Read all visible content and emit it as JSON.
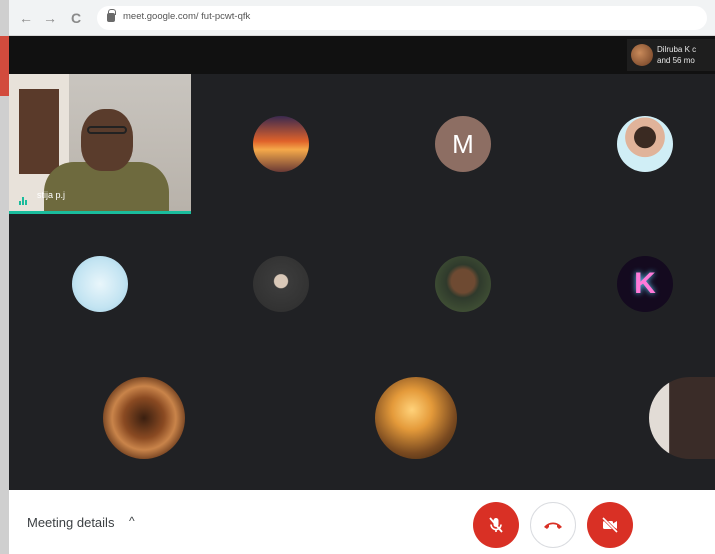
{
  "browser": {
    "url": "meet.google.com/ fut-pcwt-qfk",
    "back_label": "←",
    "forward_label": "→",
    "reload_label": "C"
  },
  "notification": {
    "line1": "Dilruba K c",
    "line2": "and 56 mo"
  },
  "presenter": {
    "name": "stija p.j"
  },
  "participants": {
    "m_letter": "M",
    "k_letter": "K"
  },
  "bottom_bar": {
    "meeting_details_label": "Meeting details",
    "chevron": "^"
  },
  "colors": {
    "accent": "#1abc9c",
    "danger": "#d93025",
    "meet_background": "#202124"
  },
  "icons": {
    "lock": "lock-icon",
    "mic_off": "mic-off-icon",
    "end_call": "hang-up-icon",
    "camera_off": "camera-off-icon",
    "chevron_up": "chevron-up-icon",
    "speaking": "speaking-indicator-icon"
  }
}
